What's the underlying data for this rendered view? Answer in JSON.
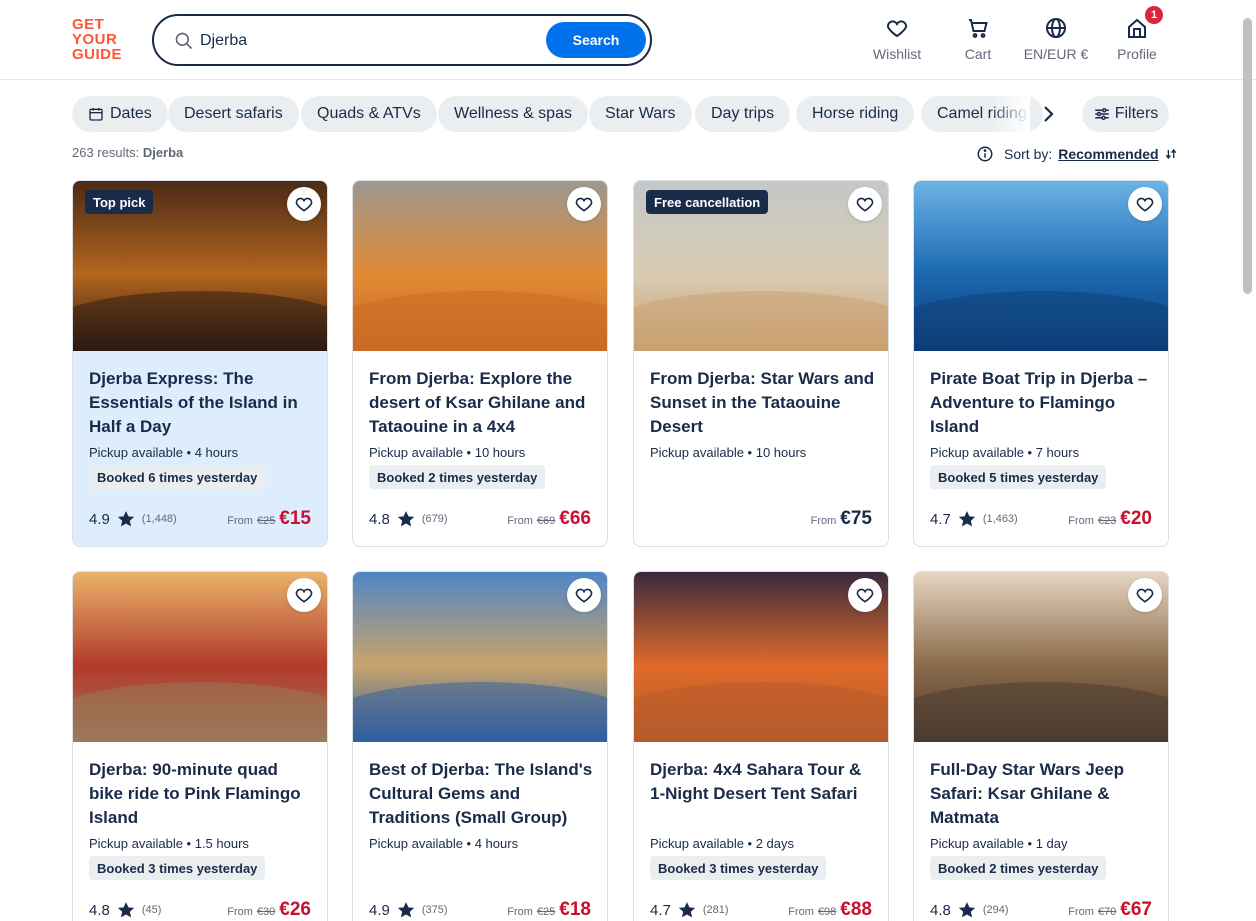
{
  "header": {
    "logo": "GET YOUR GUIDE",
    "search_value": "Djerba",
    "search_button": "Search",
    "nav": {
      "wishlist": "Wishlist",
      "cart": "Cart",
      "language": "EN/EUR €",
      "profile": "Profile",
      "profile_badge": "1"
    }
  },
  "chips": [
    "Dates",
    "Desert safaris",
    "Quads & ATVs",
    "Wellness & spas",
    "Star Wars",
    "Day trips",
    "Horse riding",
    "Camel riding"
  ],
  "filters_label": "Filters",
  "results": {
    "count_text": "263 results:",
    "query": "Djerba"
  },
  "sort": {
    "label": "Sort by:",
    "value": "Recommended"
  },
  "cards": [
    {
      "tag": "Top pick",
      "title": "Djerba Express: The Essentials of the Island in Half a Day",
      "meta": "Pickup available • 4 hours",
      "booked": "Booked 6 times yesterday",
      "rating": "4.9",
      "reviews": "(1,448)",
      "from": "From",
      "old_price": "€25",
      "price": "€15",
      "colors": [
        "#4a2a18",
        "#b5661e",
        "#2b1a12"
      ]
    },
    {
      "tag": "",
      "title": "From Djerba: Explore the desert of Ksar Ghilane and Tataouine in a 4x4",
      "meta": "Pickup available • 10 hours",
      "booked": "Booked 2 times yesterday",
      "rating": "4.8",
      "reviews": "(679)",
      "from": "From",
      "old_price": "€69",
      "price": "€66",
      "colors": [
        "#9c9890",
        "#e08a35",
        "#c96a22"
      ]
    },
    {
      "tag": "Free cancellation",
      "title": "From Djerba: Star Wars and Sunset in the Tataouine Desert",
      "meta": "Pickup available • 10 hours",
      "booked": "",
      "rating": "",
      "reviews": "",
      "from": "From",
      "old_price": "",
      "price": "€75",
      "colors": [
        "#c3c8c8",
        "#d9cbb3",
        "#c9a070"
      ]
    },
    {
      "tag": "",
      "title": "Pirate Boat Trip in Djerba – Adventure to Flamingo Island",
      "meta": "Pickup available • 7 hours",
      "booked": "Booked 5 times yesterday",
      "rating": "4.7",
      "reviews": "(1,463)",
      "from": "From",
      "old_price": "€23",
      "price": "€20",
      "colors": [
        "#6cb3e6",
        "#1b68b0",
        "#0d3d78"
      ]
    },
    {
      "tag": "",
      "title": "Djerba: 90-minute quad bike ride to Pink Flamingo Island",
      "meta": "Pickup available • 1.5 hours",
      "booked": "Booked 3 times yesterday",
      "rating": "4.8",
      "reviews": "(45)",
      "from": "From",
      "old_price": "€30",
      "price": "€26",
      "colors": [
        "#e8b46a",
        "#b33a2a",
        "#9a7a5a"
      ]
    },
    {
      "tag": "",
      "title": "Best of Djerba: The Island's Cultural Gems and Traditions (Small Group)",
      "meta": "Pickup available • 4 hours",
      "booked": "",
      "rating": "4.9",
      "reviews": "(375)",
      "from": "From",
      "old_price": "€25",
      "price": "€18",
      "colors": [
        "#4f86c6",
        "#c9a36a",
        "#2e5fa0"
      ]
    },
    {
      "tag": "",
      "title": "Djerba: 4x4 Sahara Tour & 1-Night Desert Tent Safari",
      "meta": "Pickup available • 2 days",
      "booked": "Booked 3 times yesterday",
      "rating": "4.7",
      "reviews": "(281)",
      "from": "From",
      "old_price": "€98",
      "price": "€88",
      "colors": [
        "#3a2a3e",
        "#e06a2a",
        "#b55a2a"
      ]
    },
    {
      "tag": "",
      "title": "Full-Day Star Wars Jeep Safari: Ksar Ghilane & Matmata",
      "meta": "Pickup available • 1 day",
      "booked": "Booked 2 times yesterday",
      "rating": "4.8",
      "reviews": "(294)",
      "from": "From",
      "old_price": "€70",
      "price": "€67",
      "colors": [
        "#e6d6c2",
        "#8a6a4a",
        "#4a3a2e"
      ]
    }
  ]
}
